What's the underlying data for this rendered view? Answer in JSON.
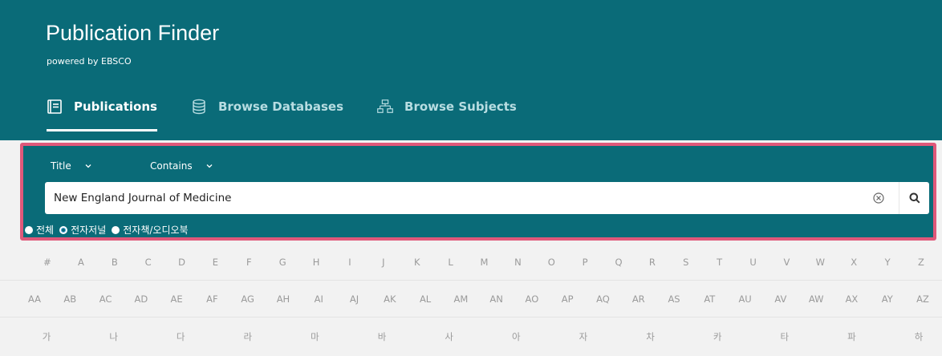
{
  "brand": {
    "title": "Publication Finder",
    "subtitle": "powered by EBSCO"
  },
  "tabs": [
    {
      "label": "Publications",
      "icon": "book-icon",
      "active": true
    },
    {
      "label": "Browse Databases",
      "icon": "database-icon",
      "active": false
    },
    {
      "label": "Browse Subjects",
      "icon": "hierarchy-icon",
      "active": false
    }
  ],
  "search": {
    "field": "Title",
    "operator": "Contains",
    "query": "New England Journal of Medicine",
    "filters": [
      {
        "label": "전체",
        "selected": false
      },
      {
        "label": "전자저널",
        "selected": true
      },
      {
        "label": "전자책/오디오북",
        "selected": false
      }
    ]
  },
  "browse": {
    "row1": [
      "#",
      "A",
      "B",
      "C",
      "D",
      "E",
      "F",
      "G",
      "H",
      "I",
      "J",
      "K",
      "L",
      "M",
      "N",
      "O",
      "P",
      "Q",
      "R",
      "S",
      "T",
      "U",
      "V",
      "W",
      "X",
      "Y",
      "Z"
    ],
    "row2": [
      "AA",
      "AB",
      "AC",
      "AD",
      "AE",
      "AF",
      "AG",
      "AH",
      "AI",
      "AJ",
      "AK",
      "AL",
      "AM",
      "AN",
      "AO",
      "AP",
      "AQ",
      "AR",
      "AS",
      "AT",
      "AU",
      "AV",
      "AW",
      "AX",
      "AY",
      "AZ"
    ],
    "row3": [
      "가",
      "나",
      "다",
      "라",
      "마",
      "바",
      "사",
      "아",
      "자",
      "차",
      "카",
      "타",
      "파",
      "하"
    ]
  },
  "colors": {
    "header": "#0a6b78",
    "highlight_border": "#e0587a",
    "background": "#f2f2f2"
  }
}
